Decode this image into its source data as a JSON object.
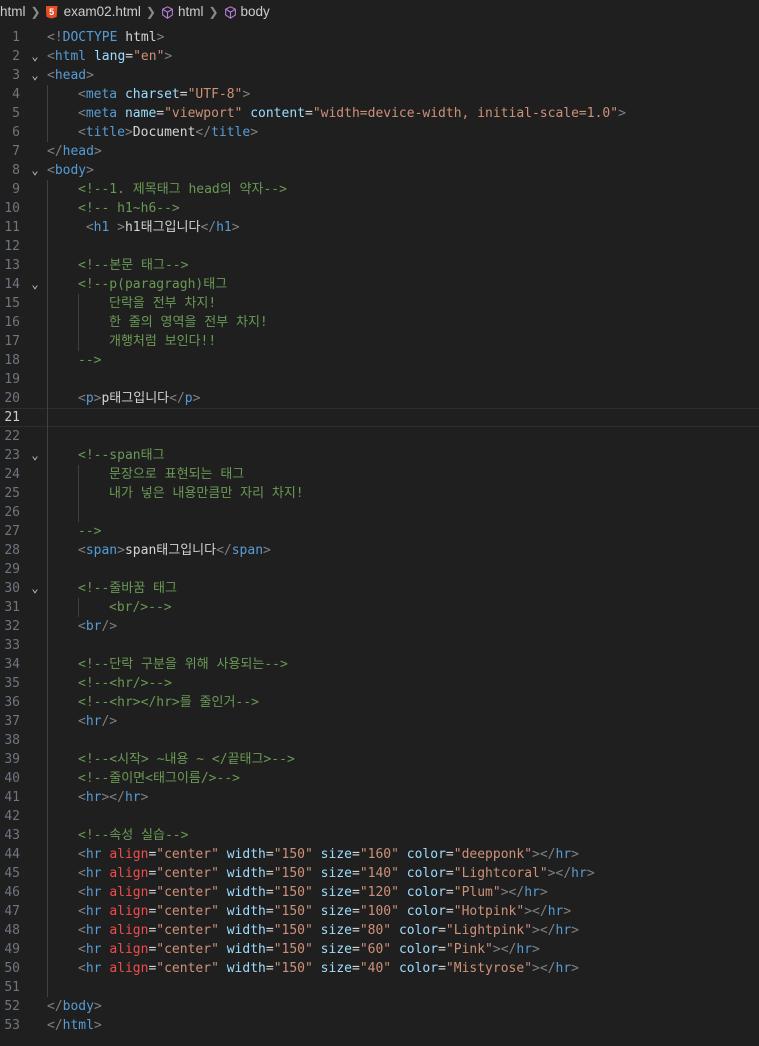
{
  "breadcrumb": {
    "items": [
      "html",
      "exam02.html",
      "html",
      "body"
    ]
  },
  "editor": {
    "current_line": 21,
    "lines": [
      {
        "n": 1,
        "fold": false,
        "indent": 0,
        "tokens": [
          [
            "br",
            "<!"
          ],
          [
            "tag",
            "DOCTYPE "
          ],
          [
            "txt",
            "html"
          ],
          [
            "br",
            ">"
          ]
        ]
      },
      {
        "n": 2,
        "fold": true,
        "indent": 0,
        "tokens": [
          [
            "br",
            "<"
          ],
          [
            "tag",
            "html "
          ],
          [
            "attr",
            "lang"
          ],
          [
            "eq",
            "="
          ],
          [
            "str",
            "\"en\""
          ],
          [
            "br",
            ">"
          ]
        ]
      },
      {
        "n": 3,
        "fold": true,
        "indent": 0,
        "tokens": [
          [
            "br",
            "<"
          ],
          [
            "tag",
            "head"
          ],
          [
            "br",
            ">"
          ]
        ]
      },
      {
        "n": 4,
        "fold": false,
        "indent": 1,
        "tokens": [
          [
            "br",
            "<"
          ],
          [
            "tag",
            "meta "
          ],
          [
            "attr",
            "charset"
          ],
          [
            "eq",
            "="
          ],
          [
            "str",
            "\"UTF-8\""
          ],
          [
            "br",
            ">"
          ]
        ]
      },
      {
        "n": 5,
        "fold": false,
        "indent": 1,
        "tokens": [
          [
            "br",
            "<"
          ],
          [
            "tag",
            "meta "
          ],
          [
            "attr",
            "name"
          ],
          [
            "eq",
            "="
          ],
          [
            "str",
            "\"viewport\" "
          ],
          [
            "attr",
            "content"
          ],
          [
            "eq",
            "="
          ],
          [
            "str",
            "\"width=device-width, initial-scale=1.0\""
          ],
          [
            "br",
            ">"
          ]
        ]
      },
      {
        "n": 6,
        "fold": false,
        "indent": 1,
        "tokens": [
          [
            "br",
            "<"
          ],
          [
            "tag",
            "title"
          ],
          [
            "br",
            ">"
          ],
          [
            "txt",
            "Document"
          ],
          [
            "br",
            "</"
          ],
          [
            "tag",
            "title"
          ],
          [
            "br",
            ">"
          ]
        ]
      },
      {
        "n": 7,
        "fold": false,
        "indent": 0,
        "tokens": [
          [
            "br",
            "</"
          ],
          [
            "tag",
            "head"
          ],
          [
            "br",
            ">"
          ]
        ]
      },
      {
        "n": 8,
        "fold": true,
        "indent": 0,
        "tokens": [
          [
            "br",
            "<"
          ],
          [
            "tag",
            "body"
          ],
          [
            "br",
            ">"
          ]
        ]
      },
      {
        "n": 9,
        "fold": false,
        "indent": 1,
        "tokens": [
          [
            "com",
            "<!--1. 제목태그 head의 약자-->"
          ]
        ]
      },
      {
        "n": 10,
        "fold": false,
        "indent": 1,
        "tokens": [
          [
            "com",
            "<!-- h1~h6-->"
          ]
        ]
      },
      {
        "n": 11,
        "fold": false,
        "indent": 1,
        "tokens": [
          [
            "txt",
            " "
          ],
          [
            "br",
            "<"
          ],
          [
            "tag",
            "h1 "
          ],
          [
            "br",
            ">"
          ],
          [
            "txt",
            "h1태그입니다"
          ],
          [
            "br",
            "</"
          ],
          [
            "tag",
            "h1"
          ],
          [
            "br",
            ">"
          ]
        ]
      },
      {
        "n": 12,
        "fold": false,
        "indent": 1,
        "tokens": []
      },
      {
        "n": 13,
        "fold": false,
        "indent": 1,
        "tokens": [
          [
            "com",
            "<!--본문 태그-->"
          ]
        ]
      },
      {
        "n": 14,
        "fold": true,
        "indent": 1,
        "tokens": [
          [
            "com",
            "<!--p(paragragh)태그"
          ]
        ]
      },
      {
        "n": 15,
        "fold": false,
        "indent": 2,
        "tokens": [
          [
            "com",
            "단락을 전부 차지!"
          ]
        ]
      },
      {
        "n": 16,
        "fold": false,
        "indent": 2,
        "tokens": [
          [
            "com",
            "한 줄의 영역을 전부 차지!"
          ]
        ]
      },
      {
        "n": 17,
        "fold": false,
        "indent": 2,
        "tokens": [
          [
            "com",
            "개행처럼 보인다!!"
          ]
        ]
      },
      {
        "n": 18,
        "fold": false,
        "indent": 1,
        "tokens": [
          [
            "com",
            "-->"
          ]
        ]
      },
      {
        "n": 19,
        "fold": false,
        "indent": 1,
        "tokens": []
      },
      {
        "n": 20,
        "fold": false,
        "indent": 1,
        "tokens": [
          [
            "br",
            "<"
          ],
          [
            "tag",
            "p"
          ],
          [
            "br",
            ">"
          ],
          [
            "txt",
            "p태그입니다"
          ],
          [
            "br",
            "</"
          ],
          [
            "tag",
            "p"
          ],
          [
            "br",
            ">"
          ]
        ]
      },
      {
        "n": 21,
        "fold": false,
        "indent": 1,
        "tokens": []
      },
      {
        "n": 22,
        "fold": false,
        "indent": 1,
        "tokens": []
      },
      {
        "n": 23,
        "fold": true,
        "indent": 1,
        "tokens": [
          [
            "com",
            "<!--span태그"
          ]
        ]
      },
      {
        "n": 24,
        "fold": false,
        "indent": 2,
        "tokens": [
          [
            "com",
            "문장으로 표현되는 태그"
          ]
        ]
      },
      {
        "n": 25,
        "fold": false,
        "indent": 2,
        "tokens": [
          [
            "com",
            "내가 넣은 내용만큼만 자리 차지!"
          ]
        ]
      },
      {
        "n": 26,
        "fold": false,
        "indent": 2,
        "tokens": []
      },
      {
        "n": 27,
        "fold": false,
        "indent": 1,
        "tokens": [
          [
            "com",
            "-->"
          ]
        ]
      },
      {
        "n": 28,
        "fold": false,
        "indent": 1,
        "tokens": [
          [
            "br",
            "<"
          ],
          [
            "tag",
            "span"
          ],
          [
            "br",
            ">"
          ],
          [
            "txt",
            "span태그입니다"
          ],
          [
            "br",
            "</"
          ],
          [
            "tag",
            "span"
          ],
          [
            "br",
            ">"
          ]
        ]
      },
      {
        "n": 29,
        "fold": false,
        "indent": 1,
        "tokens": []
      },
      {
        "n": 30,
        "fold": true,
        "indent": 1,
        "tokens": [
          [
            "com",
            "<!--줄바꿈 태그"
          ]
        ]
      },
      {
        "n": 31,
        "fold": false,
        "indent": 2,
        "tokens": [
          [
            "com",
            "<br/>-->"
          ]
        ]
      },
      {
        "n": 32,
        "fold": false,
        "indent": 1,
        "tokens": [
          [
            "br",
            "<"
          ],
          [
            "tag",
            "br"
          ],
          [
            "br",
            "/>"
          ]
        ]
      },
      {
        "n": 33,
        "fold": false,
        "indent": 1,
        "tokens": []
      },
      {
        "n": 34,
        "fold": false,
        "indent": 1,
        "tokens": [
          [
            "com",
            "<!--단락 구분을 위해 사용되는-->"
          ]
        ]
      },
      {
        "n": 35,
        "fold": false,
        "indent": 1,
        "tokens": [
          [
            "com",
            "<!--<hr/>-->"
          ]
        ]
      },
      {
        "n": 36,
        "fold": false,
        "indent": 1,
        "tokens": [
          [
            "com",
            "<!--<hr></hr>를 줄인거-->"
          ]
        ]
      },
      {
        "n": 37,
        "fold": false,
        "indent": 1,
        "tokens": [
          [
            "br",
            "<"
          ],
          [
            "tag",
            "hr"
          ],
          [
            "br",
            "/>"
          ]
        ]
      },
      {
        "n": 38,
        "fold": false,
        "indent": 1,
        "tokens": []
      },
      {
        "n": 39,
        "fold": false,
        "indent": 1,
        "tokens": [
          [
            "com",
            "<!--<시작> ~내용 ~ </끝태그>-->"
          ]
        ]
      },
      {
        "n": 40,
        "fold": false,
        "indent": 1,
        "tokens": [
          [
            "com",
            "<!--줄이면<태그이름/>-->"
          ]
        ]
      },
      {
        "n": 41,
        "fold": false,
        "indent": 1,
        "tokens": [
          [
            "br",
            "<"
          ],
          [
            "tag",
            "hr"
          ],
          [
            "br",
            "></"
          ],
          [
            "tag",
            "hr"
          ],
          [
            "br",
            ">"
          ]
        ]
      },
      {
        "n": 42,
        "fold": false,
        "indent": 1,
        "tokens": []
      },
      {
        "n": 43,
        "fold": false,
        "indent": 1,
        "tokens": [
          [
            "com",
            "<!--속성 실습-->"
          ]
        ]
      },
      {
        "n": 44,
        "fold": false,
        "indent": 1,
        "tokens": [
          [
            "br",
            "<"
          ],
          [
            "tag",
            "hr "
          ],
          [
            "red",
            "align"
          ],
          [
            "eq",
            "="
          ],
          [
            "str",
            "\"center\" "
          ],
          [
            "attr",
            "width"
          ],
          [
            "eq",
            "="
          ],
          [
            "str",
            "\"150\" "
          ],
          [
            "attr",
            "size"
          ],
          [
            "eq",
            "="
          ],
          [
            "str",
            "\"160\" "
          ],
          [
            "attr",
            "color"
          ],
          [
            "eq",
            "="
          ],
          [
            "str",
            "\"deepponk\""
          ],
          [
            "br",
            "></"
          ],
          [
            "tag",
            "hr"
          ],
          [
            "br",
            ">"
          ]
        ]
      },
      {
        "n": 45,
        "fold": false,
        "indent": 1,
        "tokens": [
          [
            "br",
            "<"
          ],
          [
            "tag",
            "hr "
          ],
          [
            "red",
            "align"
          ],
          [
            "eq",
            "="
          ],
          [
            "str",
            "\"center\" "
          ],
          [
            "attr",
            "width"
          ],
          [
            "eq",
            "="
          ],
          [
            "str",
            "\"150\" "
          ],
          [
            "attr",
            "size"
          ],
          [
            "eq",
            "="
          ],
          [
            "str",
            "\"140\" "
          ],
          [
            "attr",
            "color"
          ],
          [
            "eq",
            "="
          ],
          [
            "str",
            "\"Lightcoral\""
          ],
          [
            "br",
            "></"
          ],
          [
            "tag",
            "hr"
          ],
          [
            "br",
            ">"
          ]
        ]
      },
      {
        "n": 46,
        "fold": false,
        "indent": 1,
        "tokens": [
          [
            "br",
            "<"
          ],
          [
            "tag",
            "hr "
          ],
          [
            "red",
            "align"
          ],
          [
            "eq",
            "="
          ],
          [
            "str",
            "\"center\" "
          ],
          [
            "attr",
            "width"
          ],
          [
            "eq",
            "="
          ],
          [
            "str",
            "\"150\" "
          ],
          [
            "attr",
            "size"
          ],
          [
            "eq",
            "="
          ],
          [
            "str",
            "\"120\" "
          ],
          [
            "attr",
            "color"
          ],
          [
            "eq",
            "="
          ],
          [
            "str",
            "\"Plum\""
          ],
          [
            "br",
            "></"
          ],
          [
            "tag",
            "hr"
          ],
          [
            "br",
            ">"
          ]
        ]
      },
      {
        "n": 47,
        "fold": false,
        "indent": 1,
        "tokens": [
          [
            "br",
            "<"
          ],
          [
            "tag",
            "hr "
          ],
          [
            "red",
            "align"
          ],
          [
            "eq",
            "="
          ],
          [
            "str",
            "\"center\" "
          ],
          [
            "attr",
            "width"
          ],
          [
            "eq",
            "="
          ],
          [
            "str",
            "\"150\" "
          ],
          [
            "attr",
            "size"
          ],
          [
            "eq",
            "="
          ],
          [
            "str",
            "\"100\" "
          ],
          [
            "attr",
            "color"
          ],
          [
            "eq",
            "="
          ],
          [
            "str",
            "\"Hotpink\""
          ],
          [
            "br",
            "></"
          ],
          [
            "tag",
            "hr"
          ],
          [
            "br",
            ">"
          ]
        ]
      },
      {
        "n": 48,
        "fold": false,
        "indent": 1,
        "tokens": [
          [
            "br",
            "<"
          ],
          [
            "tag",
            "hr "
          ],
          [
            "red",
            "align"
          ],
          [
            "eq",
            "="
          ],
          [
            "str",
            "\"center\" "
          ],
          [
            "attr",
            "width"
          ],
          [
            "eq",
            "="
          ],
          [
            "str",
            "\"150\" "
          ],
          [
            "attr",
            "size"
          ],
          [
            "eq",
            "="
          ],
          [
            "str",
            "\"80\" "
          ],
          [
            "attr",
            "color"
          ],
          [
            "eq",
            "="
          ],
          [
            "str",
            "\"Lightpink\""
          ],
          [
            "br",
            "></"
          ],
          [
            "tag",
            "hr"
          ],
          [
            "br",
            ">"
          ]
        ]
      },
      {
        "n": 49,
        "fold": false,
        "indent": 1,
        "tokens": [
          [
            "br",
            "<"
          ],
          [
            "tag",
            "hr "
          ],
          [
            "red",
            "align"
          ],
          [
            "eq",
            "="
          ],
          [
            "str",
            "\"center\" "
          ],
          [
            "attr",
            "width"
          ],
          [
            "eq",
            "="
          ],
          [
            "str",
            "\"150\" "
          ],
          [
            "attr",
            "size"
          ],
          [
            "eq",
            "="
          ],
          [
            "str",
            "\"60\" "
          ],
          [
            "attr",
            "color"
          ],
          [
            "eq",
            "="
          ],
          [
            "str",
            "\"Pink\""
          ],
          [
            "br",
            "></"
          ],
          [
            "tag",
            "hr"
          ],
          [
            "br",
            ">"
          ]
        ]
      },
      {
        "n": 50,
        "fold": false,
        "indent": 1,
        "tokens": [
          [
            "br",
            "<"
          ],
          [
            "tag",
            "hr "
          ],
          [
            "red",
            "align"
          ],
          [
            "eq",
            "="
          ],
          [
            "str",
            "\"center\" "
          ],
          [
            "attr",
            "width"
          ],
          [
            "eq",
            "="
          ],
          [
            "str",
            "\"150\" "
          ],
          [
            "attr",
            "size"
          ],
          [
            "eq",
            "="
          ],
          [
            "str",
            "\"40\" "
          ],
          [
            "attr",
            "color"
          ],
          [
            "eq",
            "="
          ],
          [
            "str",
            "\"Mistyrose\""
          ],
          [
            "br",
            "></"
          ],
          [
            "tag",
            "hr"
          ],
          [
            "br",
            ">"
          ]
        ]
      },
      {
        "n": 51,
        "fold": false,
        "indent": 1,
        "tokens": []
      },
      {
        "n": 52,
        "fold": false,
        "indent": 0,
        "tokens": [
          [
            "br",
            "</"
          ],
          [
            "tag",
            "body"
          ],
          [
            "br",
            ">"
          ]
        ]
      },
      {
        "n": 53,
        "fold": false,
        "indent": 0,
        "tokens": [
          [
            "br",
            "</"
          ],
          [
            "tag",
            "html"
          ],
          [
            "br",
            ">"
          ]
        ]
      }
    ]
  }
}
